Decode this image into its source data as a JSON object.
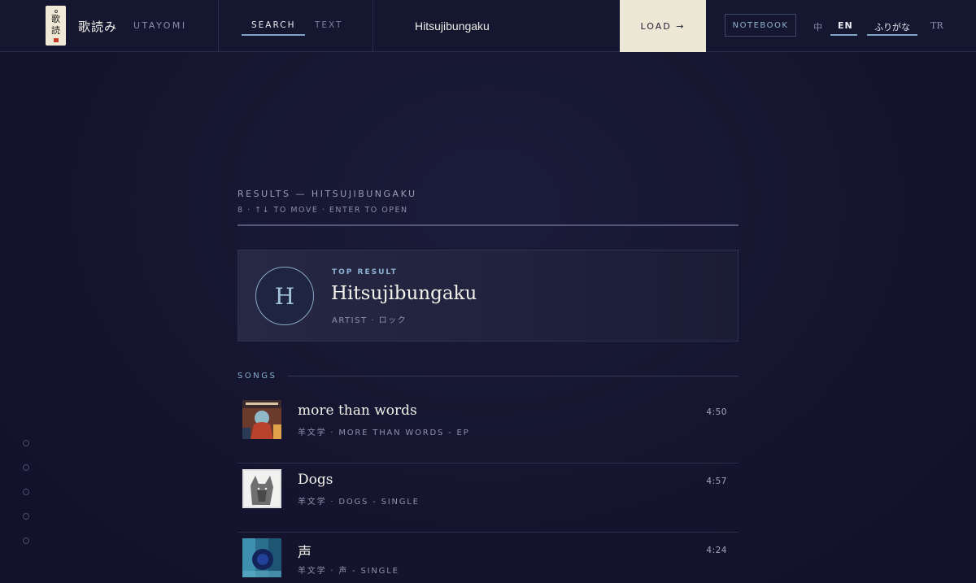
{
  "brand": {
    "logo_glyphs": [
      "歌",
      "読"
    ],
    "name_jp": "歌読み",
    "name_en": "UTAYOMI"
  },
  "modes": [
    {
      "label": "SEARCH",
      "active": true
    },
    {
      "label": "TEXT",
      "active": false
    }
  ],
  "search": {
    "value": "Hitsujibungaku",
    "load_label": "LOAD →"
  },
  "notebook_label": "NOTEBOOK",
  "languages": [
    {
      "label": "中",
      "active": false
    },
    {
      "label": "EN",
      "active": true
    },
    {
      "label": "ふりがな",
      "active": true
    },
    {
      "label": "TR",
      "active": false
    }
  ],
  "side_nav": {
    "dot_count": 5
  },
  "results": {
    "title": "RESULTS — HITSUJIBUNGAKU",
    "hint": "8 · ↑↓ TO MOVE · ENTER TO OPEN",
    "top_result": {
      "label": "TOP RESULT",
      "initial": "H",
      "name": "Hitsujibungaku",
      "meta": "ARTIST · ロック"
    },
    "songs_label": "SONGS",
    "songs": [
      {
        "title": "more than words",
        "meta": "羊文学 · MORE THAN WORDS - EP",
        "duration": "4:50"
      },
      {
        "title": "Dogs",
        "meta": "羊文学 · DOGS - SINGLE",
        "duration": "4:57"
      },
      {
        "title": "声",
        "meta": "羊文学 · 声 - SINGLE",
        "duration": "4:24"
      }
    ]
  },
  "colors": {
    "background": "#15152f",
    "accent": "#7fa4c4",
    "load_button": "#ede8d6"
  }
}
